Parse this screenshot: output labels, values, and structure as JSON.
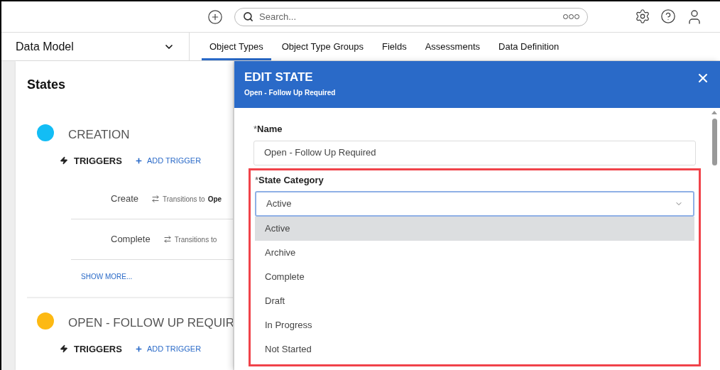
{
  "top_bar": {
    "search": {
      "placeholder": "Search..."
    }
  },
  "nav": {
    "section": "Data Model",
    "tabs": [
      {
        "label": "Object Types",
        "selected": true
      },
      {
        "label": "Object Type Groups",
        "selected": false
      },
      {
        "label": "Fields",
        "selected": false
      },
      {
        "label": "Assessments",
        "selected": false
      },
      {
        "label": "Data Definition",
        "selected": false
      }
    ]
  },
  "states_panel": {
    "title": "States",
    "states": [
      {
        "name": "CREATION",
        "color": "#13bdf5",
        "triggers_label": "TRIGGERS",
        "add_trigger": "ADD TRIGGER",
        "triggers": [
          {
            "name": "Create",
            "transition": "Transitions to",
            "target": "Ope"
          },
          {
            "name": "Complete",
            "transition": "Transitions to"
          }
        ],
        "show_more": "SHOW MORE..."
      },
      {
        "name": "OPEN - FOLLOW UP REQUIR",
        "color": "#fdb913",
        "triggers_label": "TRIGGERS",
        "add_trigger": "ADD TRIGGER"
      }
    ]
  },
  "drawer": {
    "title": "EDIT STATE",
    "subtitle": "Open - Follow Up Required",
    "fields": [
      {
        "label": "Name",
        "required_mark": "*",
        "value": "Open - Follow Up Required"
      }
    ],
    "state_category": {
      "label": "State Category",
      "required_mark": "*",
      "value": "Active",
      "highlighted": true,
      "expanded": true,
      "options": [
        {
          "label": "Active",
          "selected": true
        },
        {
          "label": "Archive",
          "selected": false
        },
        {
          "label": "Complete",
          "selected": false
        },
        {
          "label": "Draft",
          "selected": false
        },
        {
          "label": "In Progress",
          "selected": false
        },
        {
          "label": "Not Started",
          "selected": false
        }
      ]
    }
  }
}
